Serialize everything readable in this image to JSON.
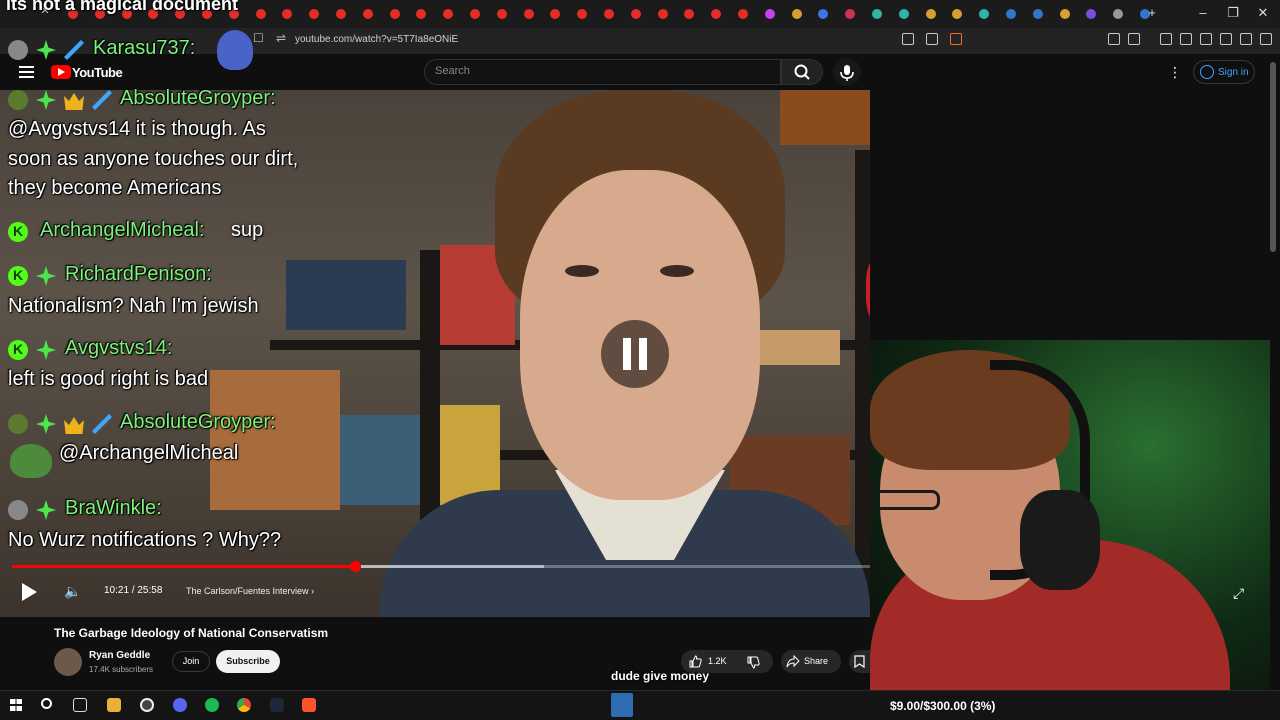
{
  "browser": {
    "url": "youtube.com/watch?v=5T7Ia8eONiE"
  },
  "youtube": {
    "wordmark": "YouTube",
    "search": {
      "placeholder": "Search"
    },
    "signin_label": "Sign in",
    "player": {
      "time": "10:21 / 25:58",
      "chapter": "The Carlson/Fuentes Interview",
      "progress_fraction": 0.4,
      "buffer_fraction": 0.62
    },
    "video": {
      "title": "The Garbage Ideology of National Conservatism",
      "channel": "Ryan Geddle",
      "subscribers": "17.4K subscribers",
      "join_label": "Join",
      "subscribe_label": "Subscribe",
      "likes": "1.2K",
      "share_label": "Share"
    }
  },
  "chat": {
    "top_message": "its not a magical document",
    "messages": [
      {
        "user": "Karasu737:",
        "lines": []
      },
      {
        "user": "AbsoluteGroyper:",
        "lines": [
          "@Avgvstvs14 it is though. As",
          "soon as anyone touches our dirt,",
          "they become Americans"
        ]
      },
      {
        "user": "ArchangelMicheal:",
        "inline": "sup"
      },
      {
        "user": "RichardPenison:",
        "lines": [
          "Nationalism? Nah I'm jewish"
        ]
      },
      {
        "user": "Avgvstvs14:",
        "lines": [
          "left is good right is bad"
        ]
      },
      {
        "user": "AbsoluteGroyper:",
        "lines": [
          "@ArchangelMicheal"
        ]
      },
      {
        "user": "BraWinkle:",
        "lines": [
          "No Wurz notifications ? Why??"
        ]
      }
    ]
  },
  "overlay": {
    "caption": "dude give money",
    "donation_goal": "$9.00/$300.00 (3%)"
  },
  "colors": {
    "chat_username": "#7cf37a",
    "yt_red": "#ff0000",
    "link_blue": "#3ea6ff"
  }
}
